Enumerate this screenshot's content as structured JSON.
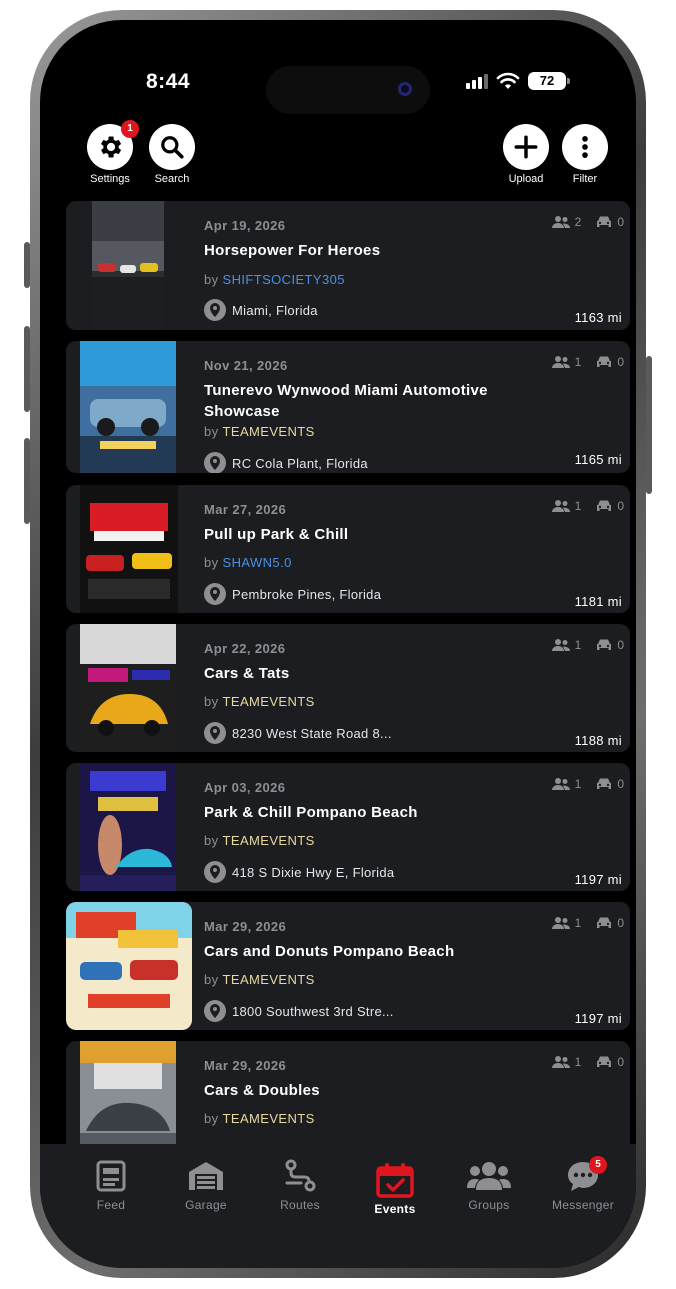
{
  "status_bar": {
    "time": "8:44",
    "battery": "72"
  },
  "top_actions": {
    "settings": {
      "label": "Settings",
      "badge": "1"
    },
    "search": {
      "label": "Search"
    },
    "upload": {
      "label": "Upload"
    },
    "filter": {
      "label": "Filter"
    }
  },
  "colors": {
    "username_blue": "#4a90e2",
    "username_gold": "#e8d8a0",
    "active_tab_red": "#e0161e"
  },
  "events": [
    {
      "date": "Apr 19, 2026",
      "title": "Horsepower For Heroes",
      "by_label": "by",
      "organizer": "SHIFTSOCIETY305",
      "organizer_color": "blue",
      "location": "Miami, Florida",
      "distance": "1163 mi",
      "attendees": "2",
      "cars": "0"
    },
    {
      "date": "Nov 21, 2026",
      "title": "Tunerevo  Wynwood Miami Automotive Showcase",
      "by_label": "by",
      "organizer": "TEAMEVENTS",
      "organizer_color": "gold",
      "location": "RC Cola Plant, Florida",
      "distance": "1165 mi",
      "attendees": "1",
      "cars": "0"
    },
    {
      "date": "Mar 27, 2026",
      "title": "Pull up Park & Chill",
      "by_label": "by",
      "organizer": "SHAWN5.0",
      "organizer_color": "blue",
      "location": "Pembroke Pines, Florida",
      "distance": "1181 mi",
      "attendees": "1",
      "cars": "0"
    },
    {
      "date": "Apr 22, 2026",
      "title": "Cars & Tats",
      "by_label": "by",
      "organizer": "TEAMEVENTS",
      "organizer_color": "gold",
      "location": "8230 West State Road 8...",
      "distance": "1188 mi",
      "attendees": "1",
      "cars": "0"
    },
    {
      "date": "Apr 03, 2026",
      "title": "Park & Chill Pompano Beach",
      "by_label": "by",
      "organizer": "TEAMEVENTS",
      "organizer_color": "gold",
      "location": "418 S Dixie Hwy E, Florida",
      "distance": "1197 mi",
      "attendees": "1",
      "cars": "0"
    },
    {
      "date": "Mar 29, 2026",
      "title": "Cars and Donuts Pompano Beach",
      "by_label": "by",
      "organizer": "TEAMEVENTS",
      "organizer_color": "gold",
      "location": "1800 Southwest 3rd Stre...",
      "distance": "1197 mi",
      "attendees": "1",
      "cars": "0"
    },
    {
      "date": "Mar 29, 2026",
      "title": "Cars & Doubles",
      "by_label": "by",
      "organizer": "TEAMEVENTS",
      "organizer_color": "gold",
      "location": "",
      "distance": "",
      "attendees": "1",
      "cars": "0"
    }
  ],
  "tabs": [
    {
      "label": "Feed",
      "icon": "feed-icon"
    },
    {
      "label": "Garage",
      "icon": "garage-icon"
    },
    {
      "label": "Routes",
      "icon": "routes-icon"
    },
    {
      "label": "Events",
      "icon": "calendar-check-icon",
      "active": true
    },
    {
      "label": "Groups",
      "icon": "groups-icon"
    },
    {
      "label": "Messenger",
      "icon": "chat-icon",
      "badge": "5"
    }
  ]
}
